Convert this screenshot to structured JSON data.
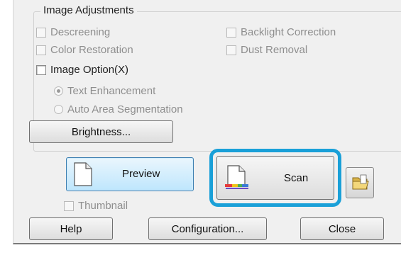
{
  "image_adjustments": {
    "title": "Image Adjustments",
    "descreening": "Descreening",
    "backlight_correction": "Backlight Correction",
    "color_restoration": "Color Restoration",
    "dust_removal": "Dust Removal",
    "image_option": "Image Option(X)",
    "text_enhancement": "Text Enhancement",
    "auto_area_segmentation": "Auto Area Segmentation",
    "brightness_button": "Brightness..."
  },
  "actions": {
    "preview_button": "Preview",
    "scan_button": "Scan",
    "thumbnail": "Thumbnail"
  },
  "footer": {
    "help_button": "Help",
    "configuration_button": "Configuration...",
    "close_button": "Close"
  },
  "colors": {
    "highlight_ring": "#1aa0d8",
    "preview_button_fill": "#bee6fd"
  },
  "icons": {
    "preview": "document-icon",
    "scan": "scanner-document-icon",
    "folder": "folder-icon"
  }
}
